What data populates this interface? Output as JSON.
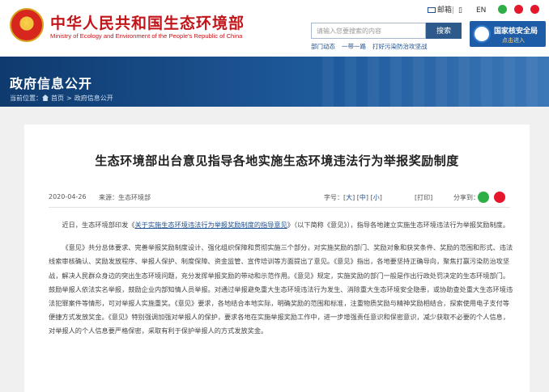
{
  "header": {
    "title_cn": "中华人民共和国生态环境部",
    "title_en": "Ministry of Ecology and Environment of the People's Republic of China",
    "top_links": {
      "mail": "邮箱",
      "lang_en": "EN"
    },
    "search": {
      "placeholder": "请输入您要搜索的内容",
      "button": "搜索"
    },
    "quick_links": [
      "部门动态",
      "一带一路",
      "打好污染防治攻坚战"
    ],
    "nnsa": {
      "title": "国家核安全局",
      "sub": "点击进入"
    }
  },
  "banner": {
    "title": "政府信息公开",
    "breadcrumb": {
      "label": "当前位置：",
      "items": [
        "首页",
        "政府信息公开"
      ]
    }
  },
  "article": {
    "title": "生态环境部出台意见指导各地实施生态环境违法行为举报奖励制度",
    "date": "2020-04-26",
    "source": "来源：生态环境部",
    "font_size": {
      "label": "字号：",
      "large": "大",
      "medium": "中",
      "small": "小"
    },
    "print": "打印",
    "share_label": "分享到：",
    "p1": {
      "before": "近日，生态环境部印发《",
      "link": "关于实施生态环境违法行为举报奖励制度的指导意见",
      "after": "》（以下简称《意见》），指导各地建立实施生态环境违法行为举报奖励制度。"
    },
    "p2": "《意见》共分总体要求、完善举报奖励制度设计、强化组织保障和贯彻实施三个部分，对实施奖励的部门、奖励对象和获奖条件、奖励的范围和形式、违法线索审核确认、奖励发放程序、举报人保护、制度保障、资金监管、宣传培训等方面提出了意见。《意见》指出，各地要坚持正确导向，聚焦打赢污染防治攻坚战，解决人民群众身边的突出生态环境问题，充分发挥举报奖励的带动和示范作用。《意见》规定，实施奖励的部门一般是作出行政处罚决定的生态环境部门。鼓励举报人依法实名举报，鼓励企业内部知情人员举报。对通过举报避免重大生态环境违法行为发生、消除重大生态环境安全隐患，或协助查处重大生态环境违法犯罪案件等情形，可对举报人实施重奖。《意见》要求，各地结合本地实际，明确奖励的范围和标准，注重物质奖励与精神奖励相结合，探索使用电子支付等便捷方式发放奖金。《意见》特别强调加强对举报人的保护，要求各地在实施举报奖励工作中，进一步增强责任意识和保密意识，减少获取不必要的个人信息，对举报人的个人信息要严格保密，采取有利于保护举报人的方式发放奖金。"
  },
  "colors": {
    "brand_red": "#c2151a",
    "banner_blue": "#1f5b9c",
    "link_blue": "#1f4f8f"
  }
}
